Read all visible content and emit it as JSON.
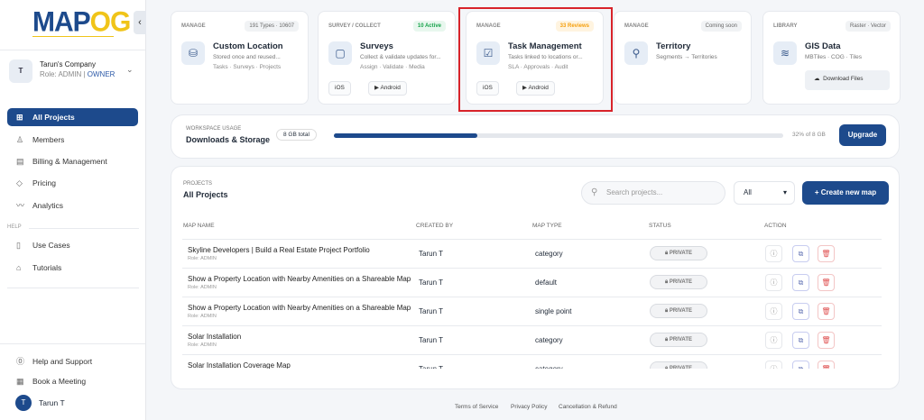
{
  "sidebar": {
    "logo": {
      "map": "MAP",
      "og": "OG"
    },
    "company": {
      "initial": "T",
      "name": "Tarun's Company",
      "role_prefix": "Role: ADMIN | ",
      "role_owner": "OWNER"
    },
    "nav": [
      {
        "label": "All Projects",
        "icon": "grid-icon"
      },
      {
        "label": "Members",
        "icon": "user-icon"
      },
      {
        "label": "Billing & Management",
        "icon": "receipt-icon"
      },
      {
        "label": "Pricing",
        "icon": "tag-icon"
      },
      {
        "label": "Analytics",
        "icon": "chart-line-icon"
      }
    ],
    "help_label": "HELP",
    "help_nav": [
      {
        "label": "Use Cases",
        "icon": "book-icon"
      },
      {
        "label": "Tutorials",
        "icon": "graduation-cap-icon"
      }
    ],
    "bottom": [
      {
        "label": "Help and Support",
        "icon": "question-icon"
      },
      {
        "label": "Book a Meeting",
        "icon": "calendar-icon"
      }
    ],
    "user": {
      "initial": "T",
      "name": "Tarun T"
    }
  },
  "features": [
    {
      "category": "MANAGE",
      "badge": "191 Types · 10607",
      "title": "Custom Location",
      "desc": "Stored once and reused...",
      "tags": "Tasks · Surveys · Projects",
      "icon": "database-icon"
    },
    {
      "category": "SURVEY / COLLECT",
      "badge": "10 Active",
      "title": "Surveys",
      "desc": "Collect & validate updates for...",
      "tags": "Assign · Validate · Media",
      "icon": "clipboard-icon",
      "ios": "iOS",
      "android": "Android"
    },
    {
      "category": "MANAGE",
      "badge": "33 Reviews",
      "title": "Task Management",
      "desc": "Tasks linked to locations or...",
      "tags": "SLA · Approvals · Audit",
      "icon": "checkbox-icon",
      "ios": "iOS",
      "android": "Android"
    },
    {
      "category": "MANAGE",
      "badge": "Coming soon",
      "title": "Territory",
      "desc": "Segments → Territories",
      "icon": "map-pin-icon"
    },
    {
      "category": "LIBRARY",
      "badge": "Raster · Vector",
      "title": "GIS Data",
      "desc": "MBTiles · COG · Tiles",
      "icon": "layers-icon",
      "download": "Download Files"
    }
  ],
  "usage": {
    "label": "WORKSPACE USAGE",
    "title": "Downloads & Storage",
    "total": "8 GB total",
    "percent": 32,
    "percent_text": "32% of 8 GB",
    "upgrade": "Upgrade"
  },
  "projects": {
    "label": "PROJECTS",
    "title": "All Projects",
    "search_placeholder": "Search projects...",
    "filter": "All",
    "create": "+  Create new map",
    "columns": [
      "MAP NAME",
      "CREATED BY",
      "MAP TYPE",
      "STATUS",
      "ACTION"
    ],
    "rows": [
      {
        "name": "Skyline Developers | Build a Real Estate Project Portfolio",
        "role": "Role: ADMIN",
        "created_by": "Tarun T",
        "type": "category",
        "status": "PRIVATE"
      },
      {
        "name": "Show a Property Location with Nearby Amenities on a Shareable Map",
        "role": "Role: ADMIN",
        "created_by": "Tarun T",
        "type": "default",
        "status": "PRIVATE"
      },
      {
        "name": "Show a Property Location with Nearby Amenities on a Shareable Map",
        "role": "Role: ADMIN",
        "created_by": "Tarun T",
        "type": "single point",
        "status": "PRIVATE"
      },
      {
        "name": "Solar Installation",
        "role": "Role: ADMIN",
        "created_by": "Tarun T",
        "type": "category",
        "status": "PRIVATE"
      },
      {
        "name": "Solar Installation Coverage Map",
        "role": "",
        "created_by": "Tarun T",
        "type": "category",
        "status": "PRIVATE"
      }
    ]
  },
  "footer": [
    "Terms of Service",
    "Privacy Policy",
    "Cancellation & Refund"
  ],
  "colors": {
    "primary": "#1d4a8c",
    "highlight": "#d8232a",
    "active_badge": "#16a34a",
    "review_badge": "#f59e0b"
  }
}
